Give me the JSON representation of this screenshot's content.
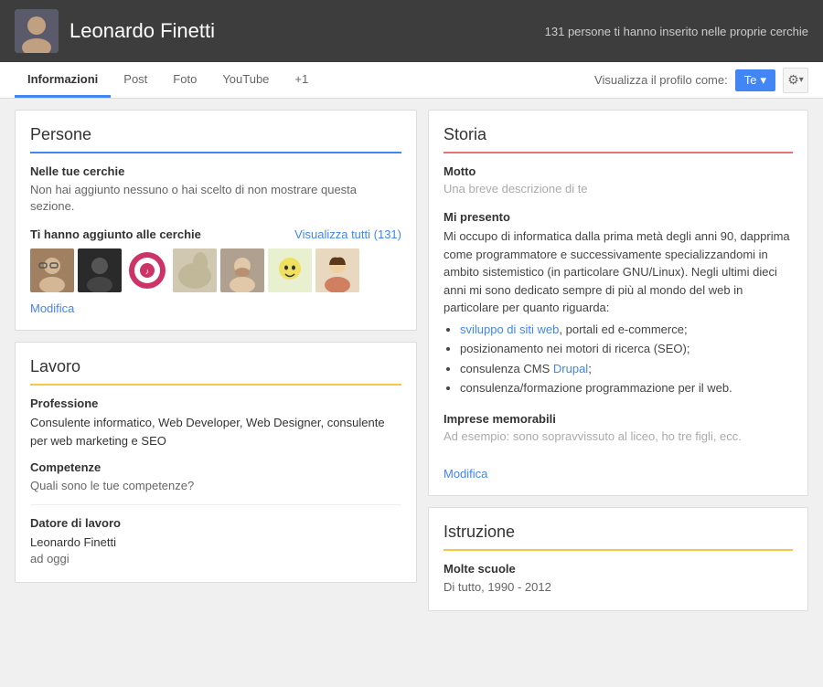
{
  "header": {
    "name": "Leonardo Finetti",
    "circles_text": "131 persone ti hanno inserito nelle proprie cerchie"
  },
  "nav": {
    "tabs": [
      {
        "label": "Informazioni",
        "active": true
      },
      {
        "label": "Post",
        "active": false
      },
      {
        "label": "Foto",
        "active": false
      },
      {
        "label": "YouTube",
        "active": false
      },
      {
        "label": "+1",
        "active": false
      }
    ],
    "view_profile_label": "Visualizza il profilo come:",
    "te_button": "Te",
    "gear_icon": "⚙"
  },
  "persone": {
    "title": "Persone",
    "nelle_tue_cerchie_label": "Nelle tue cerchie",
    "nelle_tue_cerchie_text": "Non hai aggiunto nessuno o hai scelto di non mostrare questa sezione.",
    "ti_hanno_label": "Ti hanno aggiunto alle cerchie",
    "visualizza_tutti": "Visualizza tutti (131)",
    "modifica": "Modifica"
  },
  "lavoro": {
    "title": "Lavoro",
    "professione_label": "Professione",
    "professione_value": "Consulente informatico, Web Developer, Web Designer, consulente per web marketing e SEO",
    "competenze_label": "Competenze",
    "competenze_placeholder": "Quali sono le tue competenze?",
    "datore_label": "Datore di lavoro",
    "datore_value": "Leonardo Finetti",
    "datore_sub": "ad oggi"
  },
  "storia": {
    "title": "Storia",
    "motto_label": "Motto",
    "motto_placeholder": "Una breve descrizione di te",
    "mi_presento_label": "Mi presento",
    "mi_presento_text": "Mi occupo di informatica dalla prima metà degli anni 90, dapprima come programmatore e successivamente specializzandomi in ambito sistemistico (in particolare GNU/Linux). Negli ultimi dieci anni mi sono dedicato sempre di più al mondo del web in particolare per quanto riguarda:",
    "mi_presento_items": [
      "sviluppo di siti web, portali ed e-commerce;",
      "posizionamento nei motori di ricerca (SEO);",
      "consulenza CMS Drupal;",
      "consulenza/formazione programmazione per il web."
    ],
    "sviluppo_link_text": "sviluppo di siti web",
    "drupal_link_text": "Drupal",
    "imprese_label": "Imprese memorabili",
    "imprese_placeholder": "Ad esempio: sono sopravvissuto al liceo, ho tre figli, ecc.",
    "modifica": "Modifica"
  },
  "istruzione": {
    "title": "Istruzione",
    "molte_scuole_label": "Molte scuole",
    "molte_scuole_sub": "Di tutto, 1990 - 2012"
  },
  "avatars": [
    {
      "color": "#7a6a5a",
      "label": "person1"
    },
    {
      "color": "#2d2d2d",
      "label": "person2"
    },
    {
      "color": "#cc3366",
      "label": "person3"
    },
    {
      "color": "#c0c0a0",
      "label": "person4"
    },
    {
      "color": "#8a7a6a",
      "label": "person5"
    },
    {
      "color": "#a0c080",
      "label": "person6"
    },
    {
      "color": "#c09060",
      "label": "person7"
    }
  ]
}
